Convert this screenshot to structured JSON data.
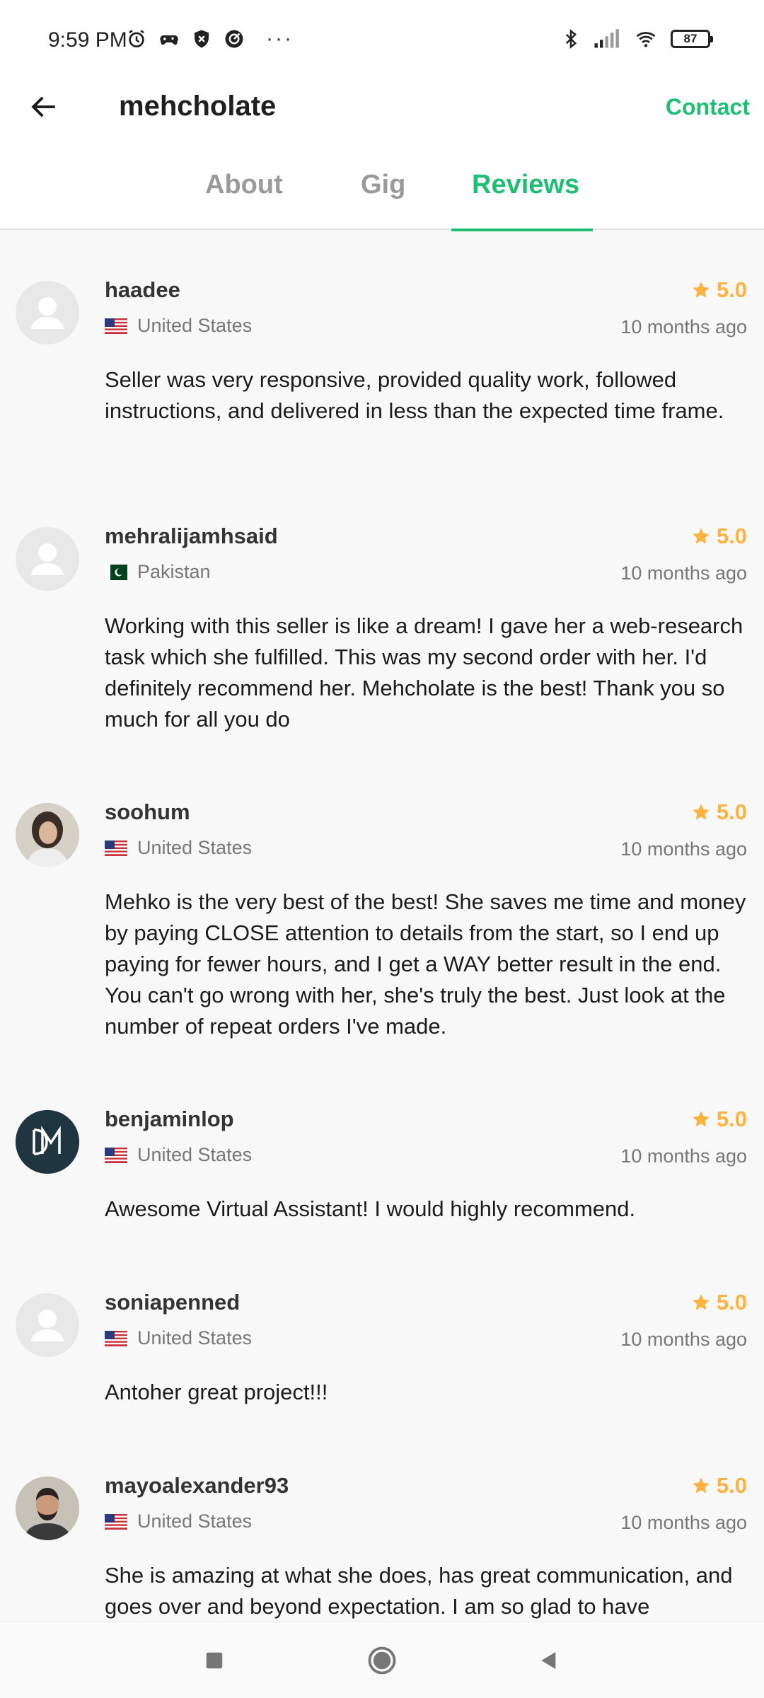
{
  "status_bar": {
    "time": "9:59 PM",
    "battery": "87",
    "left_icons": [
      "alarm-icon",
      "game-controller-icon",
      "shield-icon",
      "radar-icon"
    ],
    "right_icons": [
      "bluetooth-icon",
      "signal-icon",
      "wifi-icon",
      "battery-icon"
    ],
    "more": "···"
  },
  "header": {
    "title": "mehcholate",
    "contact_label": "Contact",
    "tabs": [
      {
        "label": "About"
      },
      {
        "label": "Gig"
      },
      {
        "label": "Reviews"
      }
    ],
    "active_tab": "Reviews",
    "accent_color": "#1dbf73"
  },
  "reviews": [
    {
      "username": "haadee",
      "rating": "5.0",
      "country": "United States",
      "time": "10 months ago",
      "text": "Seller was very responsive, provided quality work, followed instructions, and delivered in less than the expected time frame.",
      "avatar": "default-avatar"
    },
    {
      "username": "mehralijamhsaid",
      "rating": "5.0",
      "country": "Pakistan",
      "time": "10 months ago",
      "text": "Working with this seller is like a dream! I gave her a web-research task which she fulfilled. This was my second order with her. I'd definitely recommend her. Mehcholate is the best! Thank you so much for all you do",
      "avatar": "default-avatar"
    },
    {
      "username": "soohum",
      "rating": "5.0",
      "country": "United States",
      "time": "10 months ago",
      "text": "Mehko is the very best of the best! She saves me time and money by paying CLOSE attention to details from the start, so I end up paying for fewer hours, and I get a WAY better result in the end. You can't go wrong with her, she's truly the best. Just look at the number of repeat orders I've made.",
      "avatar": "photo-avatar"
    },
    {
      "username": "benjaminlop",
      "rating": "5.0",
      "country": "United States",
      "time": "10 months ago",
      "text": "Awesome Virtual Assistant! I would highly recommend.",
      "avatar": "logo-avatar"
    },
    {
      "username": "soniapenned",
      "rating": "5.0",
      "country": "United States",
      "time": "10 months ago",
      "text": "Antoher great project!!!",
      "avatar": "default-avatar"
    },
    {
      "username": "mayoalexander93",
      "rating": "5.0",
      "country": "United States",
      "time": "10 months ago",
      "text": "She is amazing at what she does, has great communication, and goes over and beyond expectation. I am so glad to have",
      "avatar": "photo-avatar"
    }
  ],
  "colors": {
    "rating": "#ffb33e",
    "accent": "#1dbf73"
  },
  "nav_bar": {
    "buttons": [
      "recents-square-icon",
      "home-circle-icon",
      "back-triangle-icon"
    ]
  }
}
